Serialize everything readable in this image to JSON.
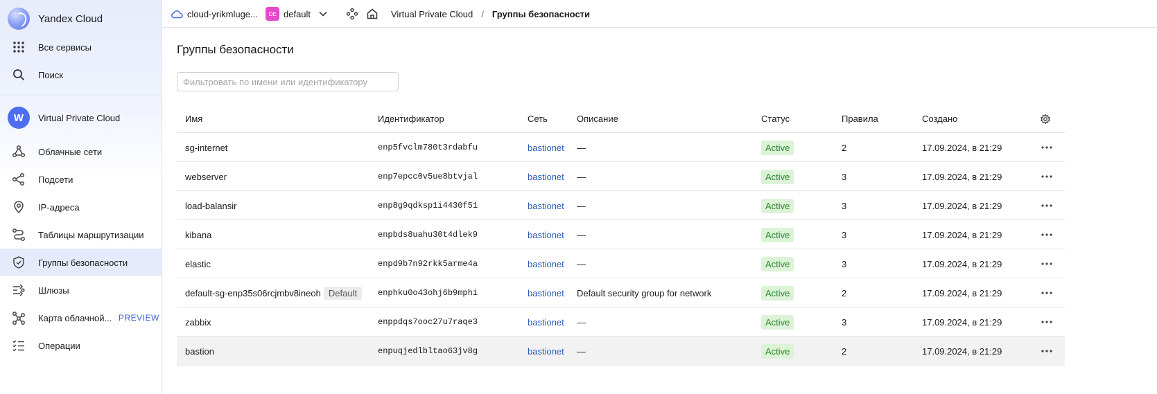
{
  "sidebar": {
    "brand": "Yandex Cloud",
    "all_services": "Все сервисы",
    "search": "Поиск",
    "service": "Virtual Private Cloud",
    "service_badge": "W",
    "items": [
      {
        "label": "Облачные сети",
        "icon": "cloud-networks-icon"
      },
      {
        "label": "Подсети",
        "icon": "subnets-icon"
      },
      {
        "label": "IP-адреса",
        "icon": "ip-address-icon"
      },
      {
        "label": "Таблицы маршрутизации",
        "icon": "routing-tables-icon"
      },
      {
        "label": "Группы безопасности",
        "icon": "shield-icon",
        "active": true
      },
      {
        "label": "Шлюзы",
        "icon": "gateways-icon"
      },
      {
        "label": "Карта облачной...",
        "icon": "cloud-map-icon",
        "badge": "PREVIEW"
      },
      {
        "label": "Операции",
        "icon": "operations-icon"
      }
    ]
  },
  "topbar": {
    "cloud": "cloud-yrikmluge...",
    "folder_badge": "DE",
    "folder": "default",
    "breadcrumb_service": "Virtual Private Cloud",
    "breadcrumb_sep": "/",
    "breadcrumb_page": "Группы безопасности"
  },
  "main": {
    "title": "Группы безопасности",
    "filter_placeholder": "Фильтровать по имени или идентификатору"
  },
  "table": {
    "columns": {
      "name": "Имя",
      "id": "Идентификатор",
      "network": "Сеть",
      "description": "Описание",
      "status": "Статус",
      "rules": "Правила",
      "created": "Создано"
    },
    "rows": [
      {
        "name": "sg-internet",
        "id": "enp5fvclm780t3rdabfu",
        "network": "bastionet",
        "description": "—",
        "status": "Active",
        "rules": "2",
        "created": "17.09.2024, в 21:29"
      },
      {
        "name": "webserver",
        "id": "enp7epcc0v5ue8btvjal",
        "network": "bastionet",
        "description": "—",
        "status": "Active",
        "rules": "3",
        "created": "17.09.2024, в 21:29"
      },
      {
        "name": "load-balansir",
        "id": "enp8g9qdksp1i4430f51",
        "network": "bastionet",
        "description": "—",
        "status": "Active",
        "rules": "3",
        "created": "17.09.2024, в 21:29"
      },
      {
        "name": "kibana",
        "id": "enpbds8uahu30t4dlek9",
        "network": "bastionet",
        "description": "—",
        "status": "Active",
        "rules": "3",
        "created": "17.09.2024, в 21:29"
      },
      {
        "name": "elastic",
        "id": "enpd9b7n92rkk5arme4a",
        "network": "bastionet",
        "description": "—",
        "status": "Active",
        "rules": "3",
        "created": "17.09.2024, в 21:29"
      },
      {
        "name": "default-sg-enp35s06rcjmbv8ineoh",
        "tag": "Default",
        "id": "enphku0o43ohj6b9mphi",
        "network": "bastionet",
        "description": "Default security group for network",
        "status": "Active",
        "rules": "2",
        "created": "17.09.2024, в 21:29"
      },
      {
        "name": "zabbix",
        "id": "enppdqs7ooc27u7raqe3",
        "network": "bastionet",
        "description": "—",
        "status": "Active",
        "rules": "3",
        "created": "17.09.2024, в 21:29"
      },
      {
        "name": "bastion",
        "id": "enpuqjedlbltao63jv8g",
        "network": "bastionet",
        "description": "—",
        "status": "Active",
        "rules": "2",
        "created": "17.09.2024, в 21:29",
        "highlighted": true
      }
    ]
  },
  "colors": {
    "accent": "#2b5bb8",
    "status_bg": "#dcf3d8",
    "status_text": "#2d8a2d",
    "active_nav": "#e5ebfa"
  }
}
